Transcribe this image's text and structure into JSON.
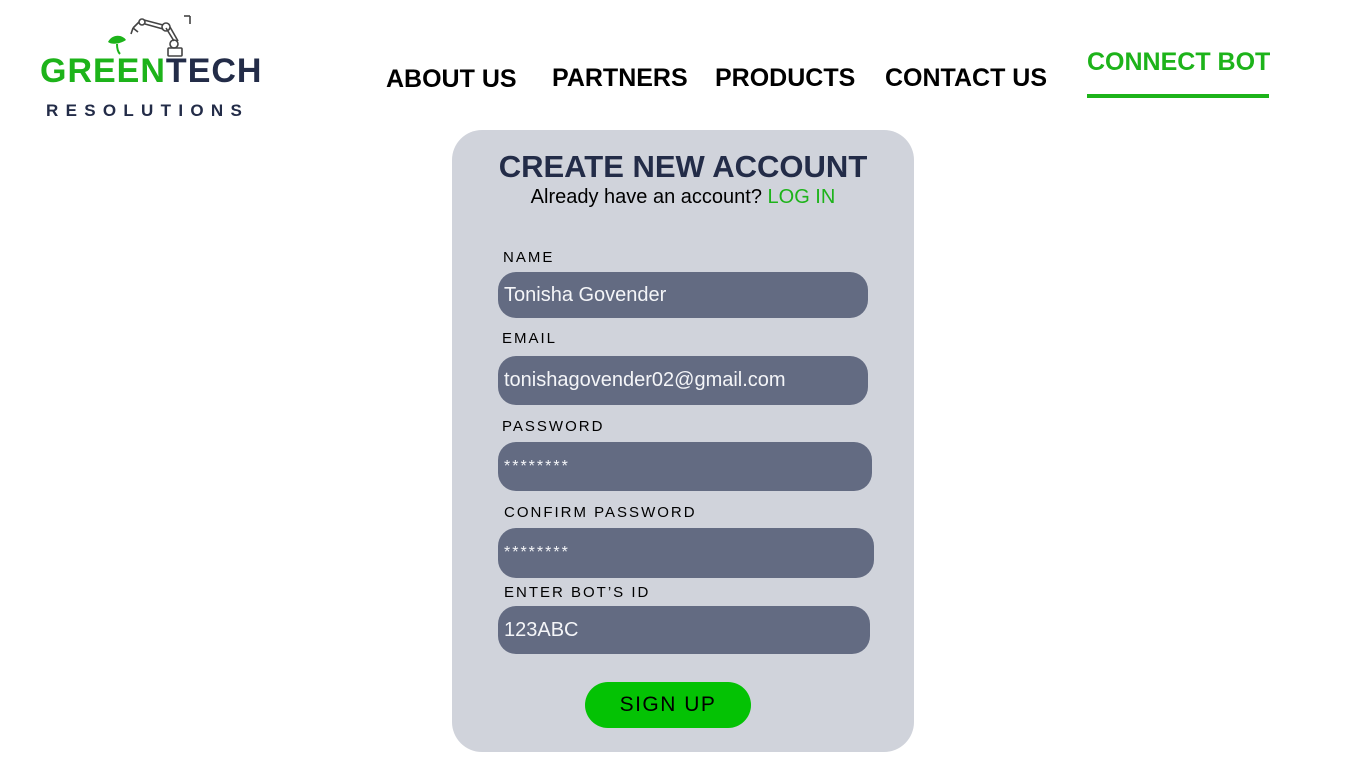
{
  "brand": {
    "name_part1": "GREEN",
    "name_part2": "TECH",
    "tagline": "RESOLUTIONS",
    "colors": {
      "green": "#1db31a",
      "navy": "#232c48"
    },
    "icon": "robot-arm-leaf-icon"
  },
  "nav": {
    "items": [
      {
        "label": "ABOUT US"
      },
      {
        "label": "PARTNERS"
      },
      {
        "label": "PRODUCTS"
      },
      {
        "label": "CONTACT US"
      },
      {
        "label": "CONNECT BOT",
        "active": true
      }
    ]
  },
  "form": {
    "title": "CREATE NEW ACCOUNT",
    "subtitle": "Already have an account?",
    "login_link": "LOG IN",
    "fields": [
      {
        "label": "NAME",
        "value": "Tonisha Govender"
      },
      {
        "label": "EMAIL",
        "value": "tonishagovender02@gmail.com"
      },
      {
        "label": "PASSWORD",
        "value": "********"
      },
      {
        "label": "CONFIRM PASSWORD",
        "value": "********"
      },
      {
        "label": "ENTER BOT’S ID",
        "value": "123ABC"
      }
    ],
    "submit_label": "SIGN UP",
    "colors": {
      "card": "#d0d3db",
      "input": "#636b82",
      "button": "#04c204"
    }
  }
}
